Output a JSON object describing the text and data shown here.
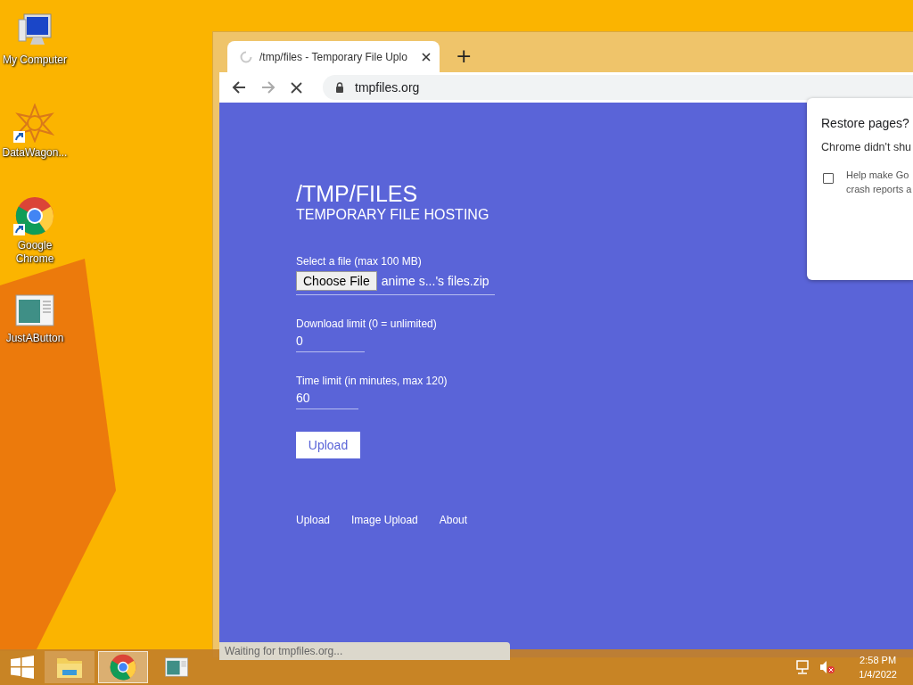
{
  "desktop_icons": [
    {
      "label": "My Computer",
      "kind": "computer",
      "shortcut": false
    },
    {
      "label": "DataWagon...",
      "kind": "star",
      "shortcut": true
    },
    {
      "label": "Google Chrome",
      "kind": "chrome",
      "shortcut": true
    },
    {
      "label": "JustAButton",
      "kind": "window",
      "shortcut": false
    }
  ],
  "browser": {
    "tab": {
      "title": "/tmp/files - Temporary File Uplo",
      "loading": true
    },
    "new_tab": "+",
    "url": "tmpfiles.org",
    "page": {
      "title": "/TMP/FILES",
      "subtitle": "TEMPORARY FILE HOSTING",
      "file_field": {
        "label": "Select a file (max 100 MB)",
        "button": "Choose File",
        "value": "anime s...'s files.zip"
      },
      "fields": [
        {
          "label": "Download limit (0 = unlimited)",
          "value": "0"
        },
        {
          "label": "Time limit (in minutes, max 120)",
          "value": "60"
        }
      ],
      "submit": "Upload",
      "links": [
        "Upload",
        "Image Upload",
        "About"
      ]
    },
    "dialog": {
      "title": "Restore pages?",
      "text": "Chrome didn't shu",
      "checkbox": {
        "checked": false,
        "lines": [
          "Help make Go",
          "crash reports a"
        ]
      }
    },
    "status": "Waiting for tmpfiles.org..."
  },
  "taskbar": {
    "apps": [
      {
        "kind": "explorer",
        "running": true,
        "selected": false
      },
      {
        "kind": "chrome",
        "running": true,
        "selected": true
      },
      {
        "kind": "window",
        "running": false,
        "selected": false
      }
    ],
    "time": "2:58 PM",
    "date": "1/4/2022"
  }
}
